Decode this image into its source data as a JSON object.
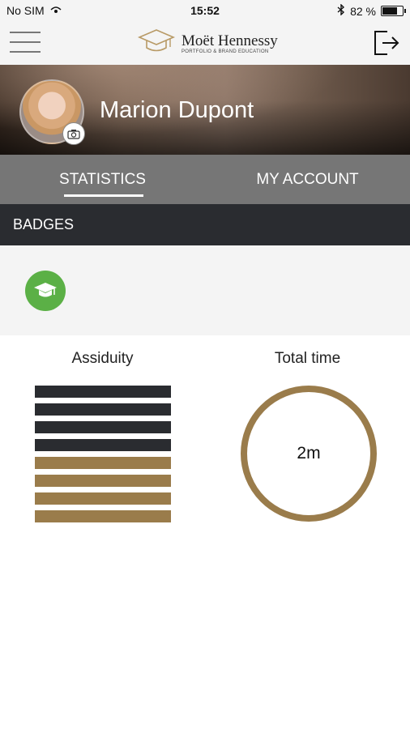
{
  "status_bar": {
    "carrier": "No SIM",
    "time": "15:52",
    "battery_text": "82 %",
    "battery_level": 0.82
  },
  "header": {
    "brand_name": "Moët Hennessy",
    "brand_tagline": "PORTFOLIO & BRAND EDUCATION",
    "menu_icon": "hamburger-icon",
    "logout_icon": "logout-icon"
  },
  "profile": {
    "name": "Marion Dupont",
    "camera_icon": "camera-icon"
  },
  "tabs": [
    {
      "label": "STATISTICS",
      "active": true
    },
    {
      "label": "MY ACCOUNT",
      "active": false
    }
  ],
  "badges": {
    "title": "BADGES",
    "items": [
      {
        "icon": "graduation-cap-icon",
        "color": "#5bb046"
      }
    ]
  },
  "stats": {
    "assiduity": {
      "label": "Assiduity",
      "bars_total": 8,
      "bars_filled": 4,
      "filled_color": "#2a2c30",
      "empty_color": "#9a7c4b"
    },
    "total_time": {
      "label": "Total time",
      "value": "2m",
      "ring_color": "#9a7c4b"
    }
  }
}
